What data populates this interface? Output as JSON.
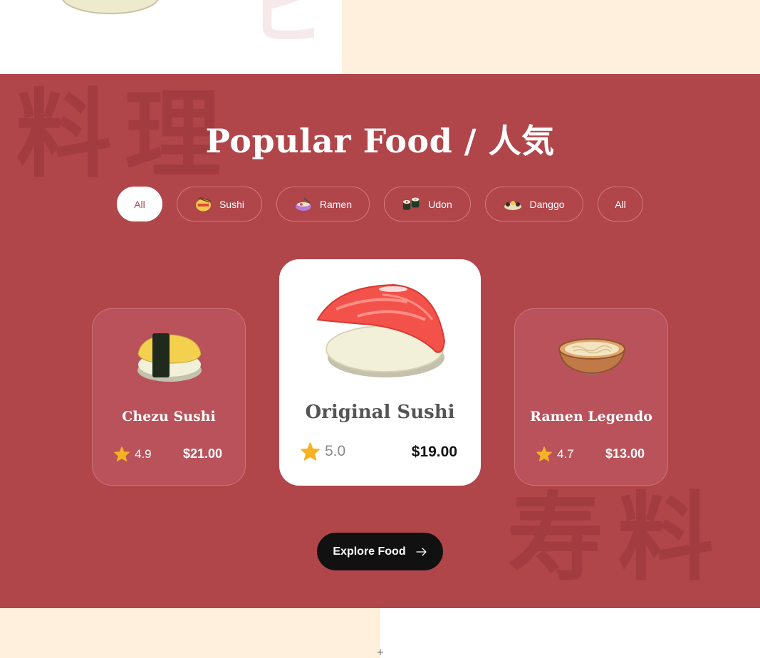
{
  "hero_top": {
    "kanji": "ヒ"
  },
  "section": {
    "title": "Popular Food / 人気",
    "bg_kanji_left": "料理",
    "bg_kanji_right": "寿料"
  },
  "tabs": [
    {
      "label": "All",
      "icon": "none",
      "active": true
    },
    {
      "label": "Sushi",
      "icon": "sushi-bowl-icon",
      "active": false
    },
    {
      "label": "Ramen",
      "icon": "ramen-bowl-icon",
      "active": false
    },
    {
      "label": "Udon",
      "icon": "maki-roll-icon",
      "active": false
    },
    {
      "label": "Danggo",
      "icon": "dango-plate-icon",
      "active": false
    },
    {
      "label": "All",
      "icon": "none",
      "active": false
    }
  ],
  "cards": [
    {
      "name": "Chezu Sushi",
      "rating": "4.9",
      "price": "$21.00",
      "image": "tamago-sushi-image"
    },
    {
      "name": "Original Sushi",
      "rating": "5.0",
      "price": "$19.00",
      "image": "salmon-nigiri-image"
    },
    {
      "name": "Ramen Legendo",
      "rating": "4.7",
      "price": "$13.00",
      "image": "ramen-bowl-image"
    }
  ],
  "cta": {
    "label": "Explore Food"
  },
  "colors": {
    "section_bg": "#b0454a",
    "cream": "#fff0dd",
    "star": "#f5b225",
    "button_bg": "#111111"
  }
}
